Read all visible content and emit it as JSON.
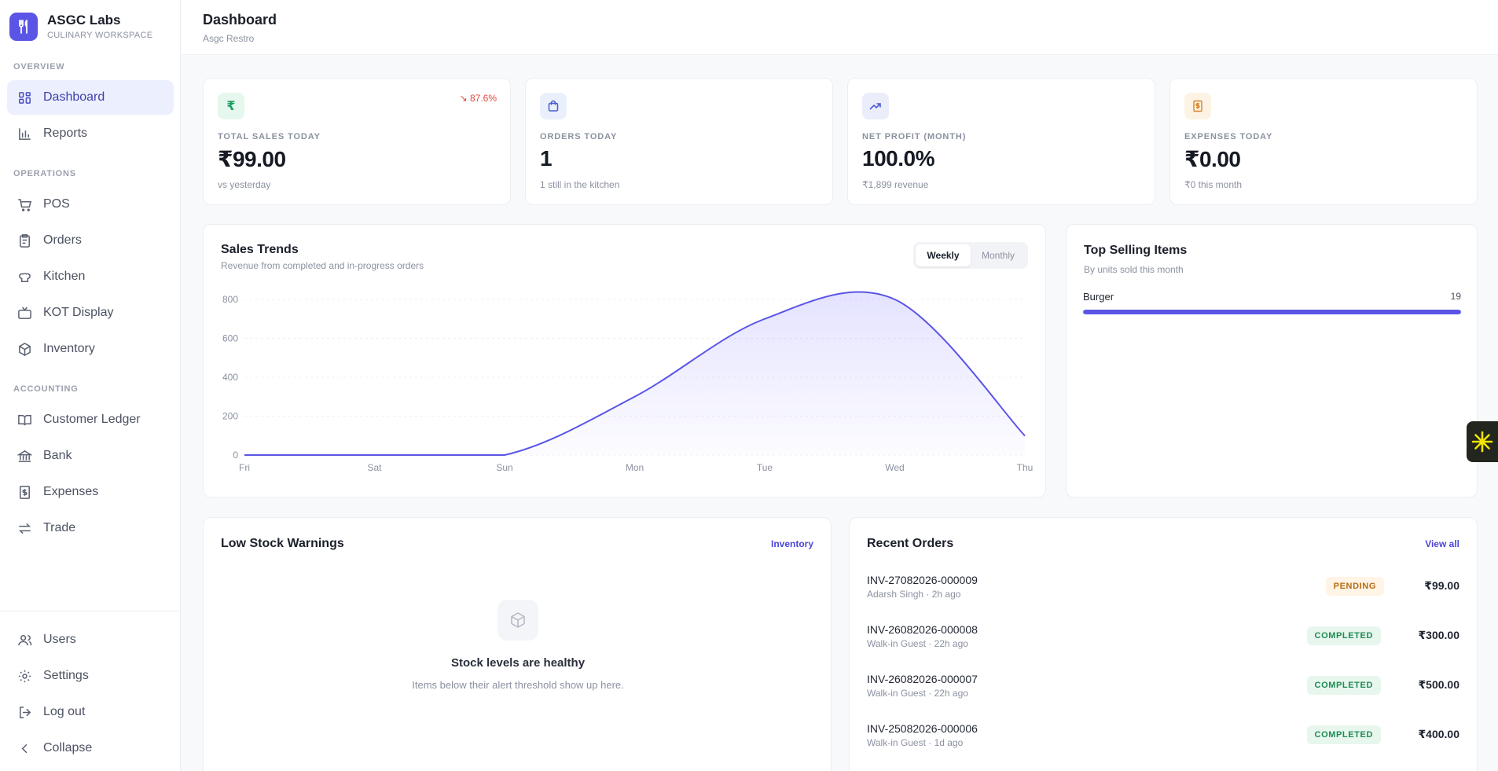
{
  "brand": {
    "name": "ASGC Labs",
    "subtitle": "CULINARY WORKSPACE"
  },
  "sidebar": {
    "sections": {
      "overview": "OVERVIEW",
      "operations": "OPERATIONS",
      "accounting": "ACCOUNTING"
    },
    "items": [
      {
        "label": "Dashboard",
        "icon": "dashboard-icon"
      },
      {
        "label": "Reports",
        "icon": "bar-chart-icon"
      },
      {
        "label": "POS",
        "icon": "cart-icon"
      },
      {
        "label": "Orders",
        "icon": "clipboard-icon"
      },
      {
        "label": "Kitchen",
        "icon": "chef-hat-icon"
      },
      {
        "label": "KOT Display",
        "icon": "tv-icon"
      },
      {
        "label": "Inventory",
        "icon": "package-icon"
      },
      {
        "label": "Customer Ledger",
        "icon": "book-icon"
      },
      {
        "label": "Bank",
        "icon": "bank-icon"
      },
      {
        "label": "Expenses",
        "icon": "receipt-icon"
      },
      {
        "label": "Trade",
        "icon": "swap-icon"
      }
    ],
    "bottom": [
      {
        "label": "Users",
        "icon": "users-icon"
      },
      {
        "label": "Settings",
        "icon": "gear-icon"
      },
      {
        "label": "Log out",
        "icon": "logout-icon"
      },
      {
        "label": "Collapse",
        "icon": "chevron-left-icon"
      }
    ]
  },
  "header": {
    "title": "Dashboard",
    "subtitle": "Asgc Restro"
  },
  "stats": [
    {
      "label": "TOTAL SALES TODAY",
      "value": "₹99.00",
      "sub": "vs yesterday",
      "trend": "↘ 87.6%",
      "icon": "rupee-icon",
      "icon_glyph": "₹",
      "color": "#1f9d62",
      "bg": "#e6f7ee"
    },
    {
      "label": "ORDERS TODAY",
      "value": "1",
      "sub": "1 still in the kitchen",
      "icon": "bag-icon",
      "color": "#4b5bd4",
      "bg": "#eaf0fb"
    },
    {
      "label": "NET PROFIT (MONTH)",
      "value": "100.0%",
      "sub": "₹1,899 revenue",
      "icon": "trending-up-icon",
      "color": "#4b5bd4",
      "bg": "#ecedfb"
    },
    {
      "label": "EXPENSES TODAY",
      "value": "₹0.00",
      "sub": "₹0 this month",
      "icon": "receipt-icon",
      "color": "#d9822b",
      "bg": "#fdf3e4"
    }
  ],
  "sales_trends": {
    "title": "Sales Trends",
    "subtitle": "Revenue from completed and in-progress orders",
    "toggle": [
      "Weekly",
      "Monthly"
    ],
    "active_toggle": "Weekly",
    "line_color": "#5b55e6"
  },
  "chart_data": {
    "type": "area",
    "categories": [
      "Fri",
      "Sat",
      "Sun",
      "Mon",
      "Tue",
      "Wed",
      "Thu"
    ],
    "values": [
      0,
      0,
      0,
      300,
      700,
      800,
      99
    ],
    "yticks": [
      0,
      200,
      400,
      600,
      800
    ],
    "ylim": [
      0,
      800
    ],
    "grid": true
  },
  "top_selling": {
    "title": "Top Selling Items",
    "subtitle": "By units sold this month",
    "items": [
      {
        "name": "Burger",
        "units": "19",
        "share": 1.0
      }
    ]
  },
  "low_stock": {
    "title": "Low Stock Warnings",
    "link": "Inventory",
    "empty_title": "Stock levels are healthy",
    "empty_sub": "Items below their alert threshold show up here."
  },
  "recent_orders": {
    "title": "Recent Orders",
    "link": "View all",
    "rows": [
      {
        "id": "INV-27082026-000009",
        "meta": "Adarsh Singh · 2h ago",
        "status": "PENDING",
        "amount": "₹99.00"
      },
      {
        "id": "INV-26082026-000008",
        "meta": "Walk-in Guest · 22h ago",
        "status": "COMPLETED",
        "amount": "₹300.00"
      },
      {
        "id": "INV-26082026-000007",
        "meta": "Walk-in Guest · 22h ago",
        "status": "COMPLETED",
        "amount": "₹500.00"
      },
      {
        "id": "INV-25082026-000006",
        "meta": "Walk-in Guest · 1d ago",
        "status": "COMPLETED",
        "amount": "₹400.00"
      }
    ]
  }
}
